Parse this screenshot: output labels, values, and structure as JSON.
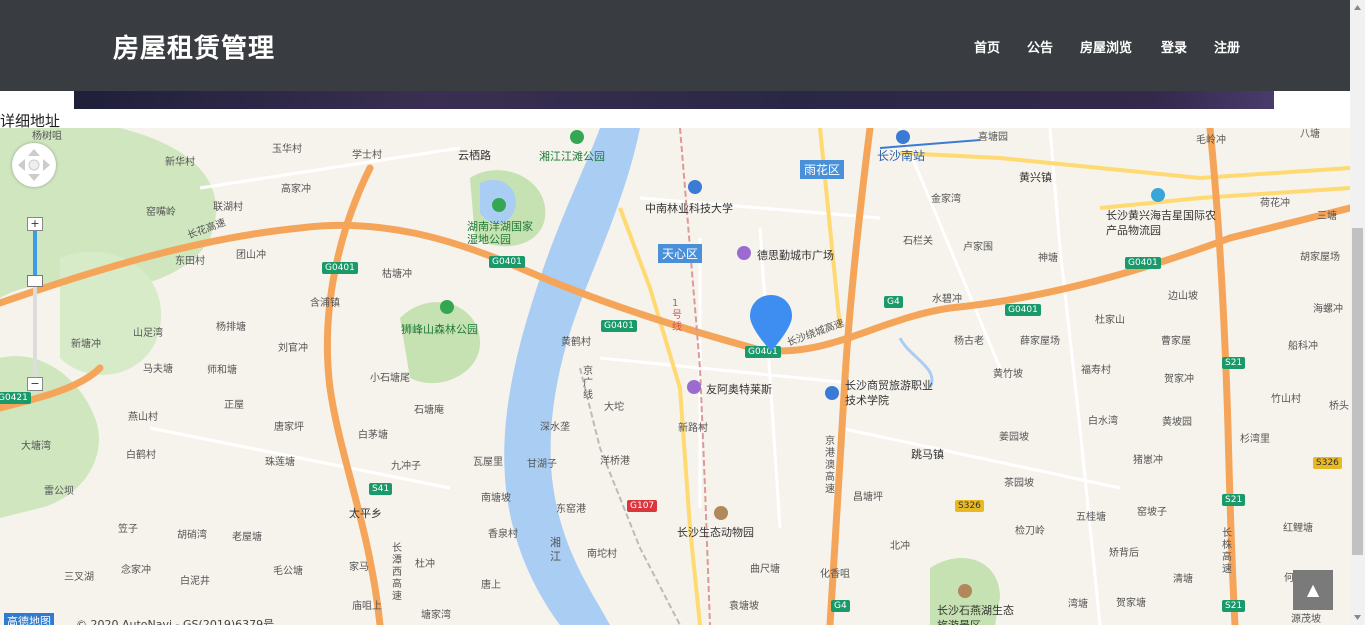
{
  "header": {
    "brand": "房屋租赁管理",
    "nav": [
      "首页",
      "公告",
      "房屋浏览",
      "登录",
      "注册"
    ]
  },
  "form": {
    "address_label": "详细地址"
  },
  "map": {
    "districts": [
      "雨花区",
      "天心区"
    ],
    "labels": {
      "l1": "杨树咀",
      "l2": "玉华村",
      "l3": "学士村",
      "l4": "云栖路",
      "l5": "湘江江滩公园",
      "l6": "长沙南站",
      "l7": "喜塘园",
      "l8": "毛岭冲",
      "l9": "八塘",
      "l10": "新华村",
      "l11": "高家冲",
      "l12": "联湖村",
      "l13": "窑嘴岭",
      "l14": "湖南洋湖国家湿地公园",
      "l15": "中南林业科技大学",
      "l16": "黄兴镇",
      "l17": "金家湾",
      "l18": "荷花冲",
      "l19": "长沙黄兴海吉星国际农产品物流园",
      "l20": "三塘",
      "l21": "长花高速",
      "l22": "东田村",
      "l23": "团山冲",
      "l24": "德思勤城市广场",
      "l25": "石栏关",
      "l26": "卢家围",
      "l27": "神塘",
      "l28": "胡家屋场",
      "l29": "枯塘冲",
      "l30": "含浦镇",
      "l31": "水碧冲",
      "l32": "边山坡",
      "l33": "海螺冲",
      "l34": "狮峰山森林公园",
      "l35": "黄鹤村",
      "l36": "长沙绕城高速",
      "l37": "杨古老",
      "l38": "薛家屋场",
      "l39": "杜家山",
      "l40": "曹家屋",
      "l41": "山足湾",
      "l42": "杨排塘",
      "l43": "刘官冲",
      "l44": "新塘冲",
      "l45": "马夫塘",
      "l46": "师和塘",
      "l47": "小石塘尾",
      "l48": "京广线",
      "l49": "友阿奥特莱斯",
      "l50": "长沙商贸旅游职业技术学院",
      "l51": "黄竹坡",
      "l52": "福寿村",
      "l53": "贺家冲",
      "l54": "船科冲",
      "l55": "大坨",
      "l56": "竹山村",
      "l57": "桥头",
      "l58": "正屋",
      "l59": "石塘庵",
      "l60": "深水垄",
      "l61": "新路村",
      "l62": "白水湾",
      "l63": "黄坡园",
      "l64": "燕山村",
      "l65": "唐家坪",
      "l66": "白茅塘",
      "l67": "京港澳高速",
      "l68": "姜园坡",
      "l69": "杉湾里",
      "l70": "大塘湾",
      "l71": "白鹤村",
      "l72": "珠莲塘",
      "l73": "九冲子",
      "l74": "瓦屋里",
      "l75": "甘湖子",
      "l76": "洋桥港",
      "l77": "跳马镇",
      "l78": "猪崽冲",
      "l79": "茶园坡",
      "l80": "雷公坝",
      "l81": "南塘坡",
      "l82": "东窑港",
      "l83": "昌塘坪",
      "l84": "五桂塘",
      "l85": "窑坡子",
      "l86": "太平乡",
      "l87": "香泉村",
      "l88": "长沙生态动物园",
      "l89": "北冲",
      "l90": "检刀岭",
      "l91": "红鲤塘",
      "l92": "笠子",
      "l93": "胡硝湾",
      "l94": "老屋塘",
      "l95": "湘江",
      "l96": "南坨村",
      "l97": "矫背后",
      "l98": "长潭西高速",
      "l99": "杜冲",
      "l100": "长株高速",
      "l101": "三叉湖",
      "l102": "念家冲",
      "l103": "白泥井",
      "l104": "毛公塘",
      "l105": "家马",
      "l106": "曲尺塘",
      "l107": "化香咀",
      "l108": "清塘",
      "l109": "何塘口",
      "l110": "唐上",
      "l111": "庙咀上",
      "l112": "塘家湾",
      "l113": "袁塘坡",
      "l114": "长沙石燕湖生态旅游景区",
      "l115": "湾塘",
      "l116": "贺家塘",
      "l117": "源茂坡",
      "l118": "1号线"
    },
    "shields": [
      "G0401",
      "G0401",
      "G0401",
      "G0401",
      "G0401",
      "G0401",
      "G4",
      "G4",
      "S21",
      "S21",
      "S21",
      "S41",
      "G107",
      "S326",
      "S326",
      "G0421"
    ],
    "logo": "高德地图",
    "copyright": "© 2020 AutoNavi - GS(2019)6379号",
    "zoom": {
      "plus": "+",
      "minus": "−"
    }
  },
  "back_to_top": "▲",
  "colors": {
    "navbar": "#393d41",
    "highway": "#f5a55a",
    "river": "#a9cdf3",
    "park": "#b8dca4",
    "marker": "#3d8ef0"
  }
}
